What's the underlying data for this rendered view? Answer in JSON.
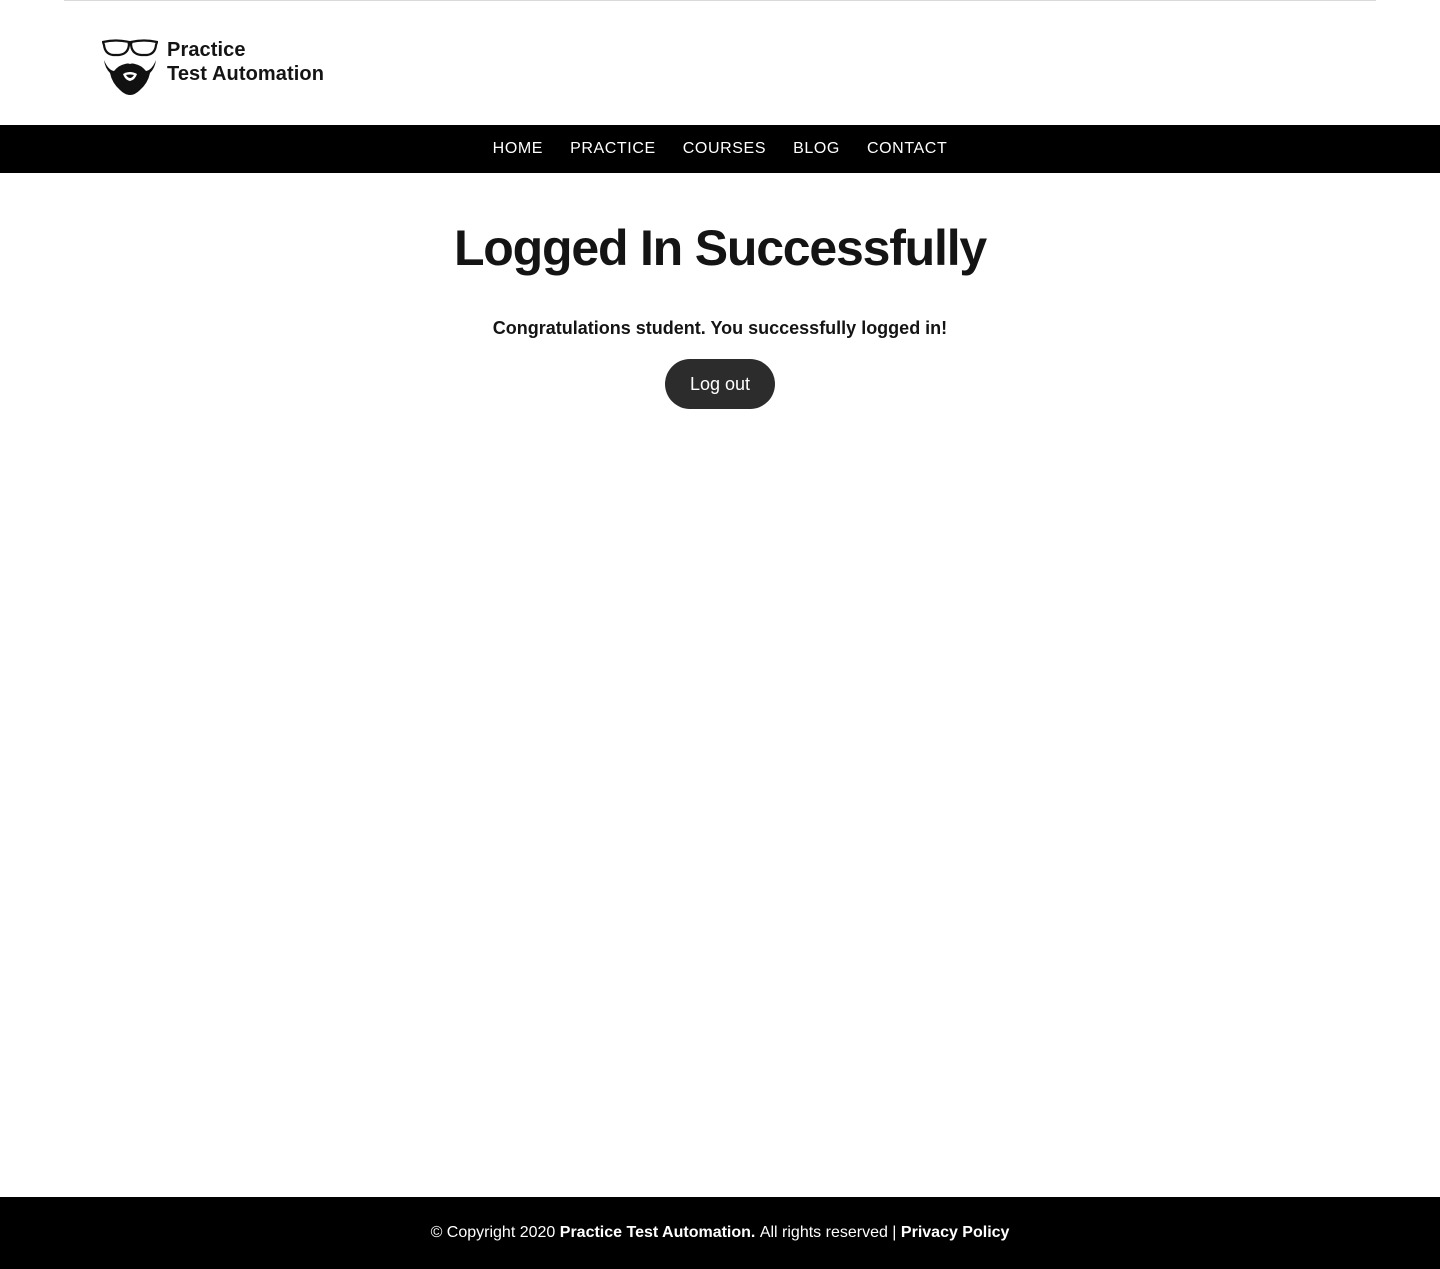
{
  "header": {
    "logo_line1": "Practice",
    "logo_line2": "Test Automation",
    "logo_icon": "glasses-beard-icon"
  },
  "nav": {
    "items": [
      {
        "label": "HOME"
      },
      {
        "label": "PRACTICE"
      },
      {
        "label": "COURSES"
      },
      {
        "label": "BLOG"
      },
      {
        "label": "CONTACT"
      }
    ]
  },
  "main": {
    "title": "Logged In Successfully",
    "message": "Congratulations student. You successfully logged in!",
    "logout_label": "Log out"
  },
  "footer": {
    "copyright": "© Copyright 2020",
    "brand": "Practice Test Automation.",
    "rights": "All rights reserved |",
    "privacy_link": "Privacy Policy"
  },
  "colors": {
    "nav_background": "#000000",
    "footer_background": "#000000",
    "button_background": "#2c2c2c",
    "text": "#141414"
  }
}
